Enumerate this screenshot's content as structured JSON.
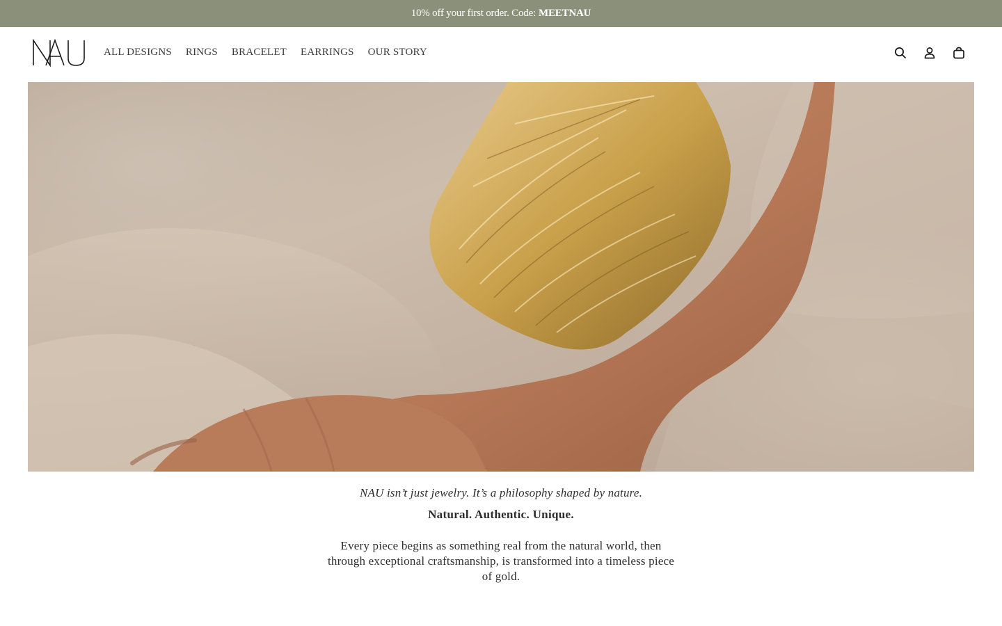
{
  "promo": {
    "text": "10% off your first order. Code:",
    "code": "MEETNAU"
  },
  "brand": {
    "logo_text": "NAU"
  },
  "nav": {
    "items": [
      {
        "label": "ALL DESIGNS"
      },
      {
        "label": "RINGS"
      },
      {
        "label": "BRACELET"
      },
      {
        "label": "EARRINGS"
      },
      {
        "label": "OUR STORY"
      }
    ]
  },
  "header_icons": [
    "search-icon",
    "account-icon",
    "cart-icon"
  ],
  "hero": {
    "image": "hand-wearing-gold-leaf-cuff-bracelet-on-linen"
  },
  "intro": {
    "tagline": "NAU isn’t just jewelry. It’s a philosophy shaped by nature.",
    "pillars": "Natural. Authentic. Unique.",
    "body": "Every piece begins as something real from the natural world, then through exceptional craftsmanship, is transformed into a timeless piece of gold."
  },
  "colors": {
    "promo_bg": "#8a9079",
    "text": "#2b2b2b",
    "gold": "#c9a04a"
  }
}
